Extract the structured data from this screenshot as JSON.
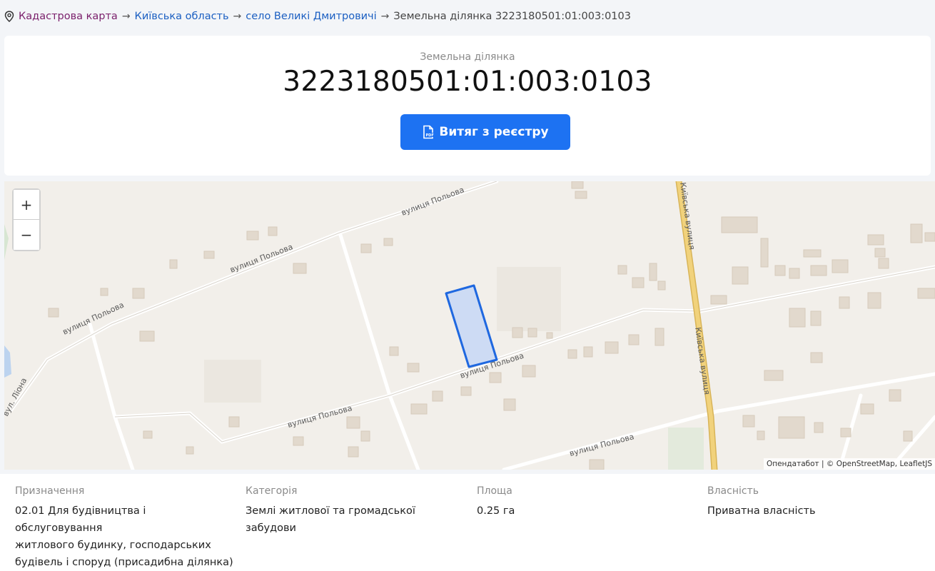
{
  "breadcrumb": {
    "items": [
      "Кадастрова карта",
      "Київська область",
      "село Великі Дмитровичі"
    ],
    "separator": "→",
    "current": "Земельна ділянка 3223180501:01:003:0103"
  },
  "header": {
    "subtitle": "Земельна ділянка",
    "title": "3223180501:01:003:0103",
    "pdf_button_label": "Витяг з реєстру"
  },
  "map": {
    "zoom_in": "+",
    "zoom_out": "−",
    "attribution": "Опендатабот | © OpenStreetMap, LeafletJS",
    "street_labels": [
      "вулиця Польова",
      "Київська вулиця",
      "вул. Ліона"
    ]
  },
  "details": {
    "purpose_label": "Призначення",
    "purpose_lines": [
      "02.01 Для будівництва і обслуговування",
      "житлового будинку, господарських",
      "будівель і споруд (присадибна ділянка)"
    ],
    "category_label": "Категорія",
    "category_value": "Землі житлової та громадської забудови",
    "area_label": "Площа",
    "area_value": "0.25 га",
    "ownership_label": "Власність",
    "ownership_value": "Приватна власність"
  },
  "colors": {
    "accent": "#1d72f2",
    "parcel_fill": "#c9d8f5",
    "parcel_stroke": "#1f68e0",
    "main_road": "#e6c46b"
  }
}
